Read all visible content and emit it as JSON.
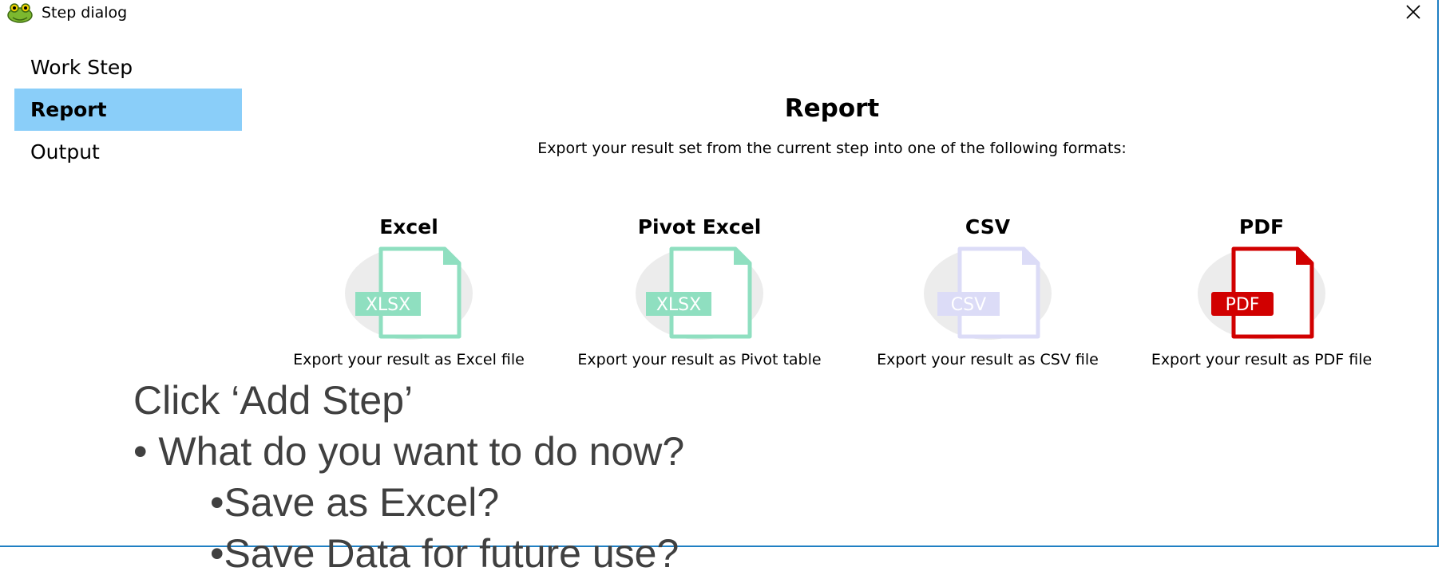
{
  "window": {
    "title": "Step dialog",
    "close_glyph": "✕"
  },
  "sidebar": {
    "items": [
      {
        "label": "Work Step"
      },
      {
        "label": "Report"
      },
      {
        "label": "Output"
      }
    ],
    "selected_index": 1
  },
  "main": {
    "heading": "Report",
    "subheading": "Export your result set from the current step into one of the following formats:",
    "options": [
      {
        "title": "Excel",
        "badge": "XLSX",
        "desc": "Export your result as Excel file",
        "color": "#8fdfc0",
        "icon": "xlsx-file-icon"
      },
      {
        "title": "Pivot Excel",
        "badge": "XLSX",
        "desc": "Export your result as Pivot table",
        "color": "#8fdfc0",
        "icon": "xlsx-file-icon"
      },
      {
        "title": "CSV",
        "badge": "CSV",
        "desc": "Export your result as CSV file",
        "color": "#dcdcf7",
        "icon": "csv-file-icon"
      },
      {
        "title": "PDF",
        "badge": "PDF",
        "desc": "Export your result as PDF file",
        "color": "#d10000",
        "icon": "pdf-file-icon"
      }
    ]
  },
  "overlay": {
    "line1": "Click ‘Add Step’",
    "line2": "• What do you want to do now?",
    "line3": "•Save as Excel?",
    "line4": "•Save Data for future use?"
  },
  "colors": {
    "selected_bg": "#8acef9",
    "border": "#1f7fc3"
  }
}
